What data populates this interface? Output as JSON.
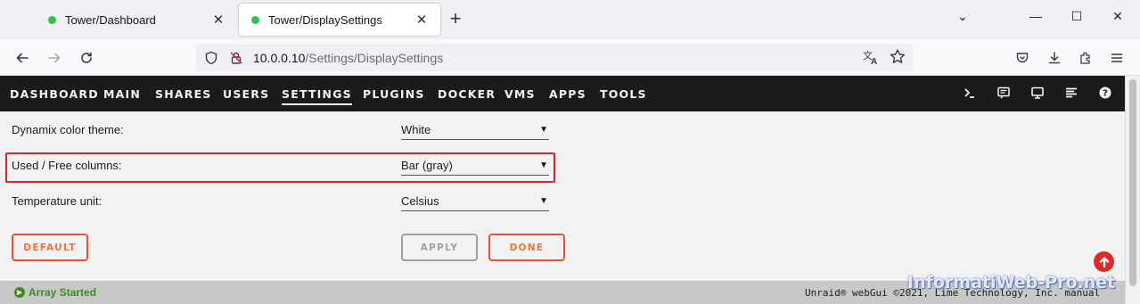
{
  "browser": {
    "tabs": [
      {
        "label": "Tower/Dashboard",
        "active": false,
        "status_color": "#34c24f"
      },
      {
        "label": "Tower/DisplaySettings",
        "active": true,
        "status_color": "#34c24f"
      }
    ],
    "close_glyph": "✕",
    "new_tab_glyph": "+",
    "window_controls": {
      "list_all_tabs": "⌄",
      "minimize": "—",
      "maximize": "☐",
      "close": "✕"
    },
    "url": {
      "host": "10.0.0.10",
      "path": "/Settings/DisplaySettings"
    },
    "icons": [
      "back-arrow-icon",
      "forward-arrow-icon",
      "reload-icon",
      "shield-icon",
      "insecure-lock-icon",
      "translate-icon",
      "bookmark-star-icon",
      "pocket-icon",
      "download-icon",
      "extensions-icon",
      "menu-icon"
    ]
  },
  "unraid_nav": {
    "items": [
      {
        "label": "DASHBOARD",
        "active": false
      },
      {
        "label": "MAIN",
        "active": false
      },
      {
        "label": "SHARES",
        "active": false
      },
      {
        "label": "USERS",
        "active": false
      },
      {
        "label": "SETTINGS",
        "active": true
      },
      {
        "label": "PLUGINS",
        "active": false
      },
      {
        "label": "DOCKER",
        "active": false
      },
      {
        "label": "VMS",
        "active": false
      },
      {
        "label": "APPS",
        "active": false
      },
      {
        "label": "TOOLS",
        "active": false
      }
    ],
    "right_icons": [
      "terminal-icon",
      "feedback-icon",
      "info-monitor-icon",
      "log-icon",
      "help-icon"
    ]
  },
  "settings": {
    "rows": [
      {
        "label": "Dynamix color theme:",
        "value": "White",
        "highlighted": false
      },
      {
        "label": "Used / Free columns:",
        "value": "Bar (gray)",
        "highlighted": true
      },
      {
        "label": "Temperature unit:",
        "value": "Celsius",
        "highlighted": false
      }
    ],
    "buttons": {
      "default": "DEFAULT",
      "apply": "APPLY",
      "done": "DONE"
    },
    "highlight_color": "#e0222a"
  },
  "footer": {
    "array_status": "Array Started",
    "copyright": "Unraid® webGui ©2021, Lime Technology, Inc. manual"
  },
  "watermark": "InformatiWeb-Pro.net",
  "colors": {
    "accent": "#f0743a",
    "nav_bg": "#1c1b1b",
    "array_started": "#3c8a22"
  }
}
